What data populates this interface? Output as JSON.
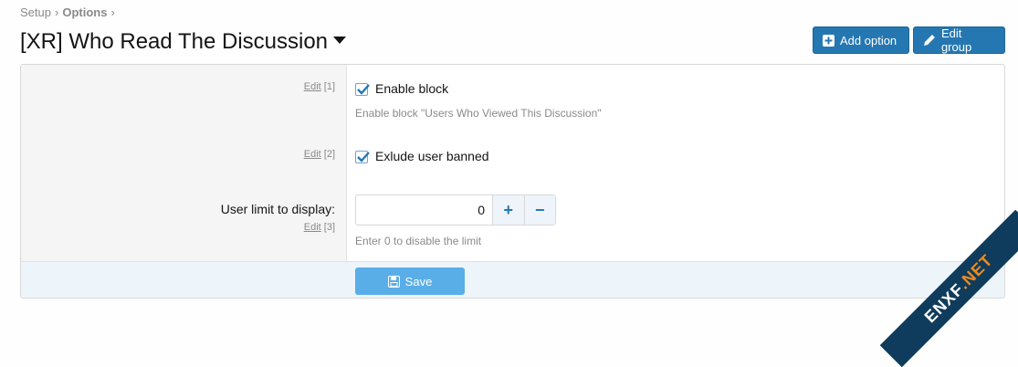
{
  "breadcrumb": {
    "root": "Setup",
    "current": "Options",
    "sep": "›"
  },
  "page": {
    "title": "[XR] Who Read The Discussion"
  },
  "toolbar": {
    "add_option": "Add option",
    "edit_group": "Edit group"
  },
  "options": [
    {
      "edit_label": "Edit",
      "order": "[1]",
      "label": "Enable block",
      "hint": "Enable block \"Users Who Viewed This Discussion\"",
      "checked": true
    },
    {
      "edit_label": "Edit",
      "order": "[2]",
      "label": "Exlude user banned",
      "checked": true
    },
    {
      "edit_label": "Edit",
      "order": "[3]",
      "label": "User limit to display:",
      "value": "0",
      "hint": "Enter 0 to disable the limit",
      "plus": "+",
      "minus": "−"
    }
  ],
  "footer": {
    "save_label": "Save"
  },
  "watermark": {
    "text_main": "ENXF",
    "text_suffix": ".NET"
  },
  "colors": {
    "accent": "#2577b1",
    "save": "#59aee8",
    "checkbox": "#2577b1"
  }
}
